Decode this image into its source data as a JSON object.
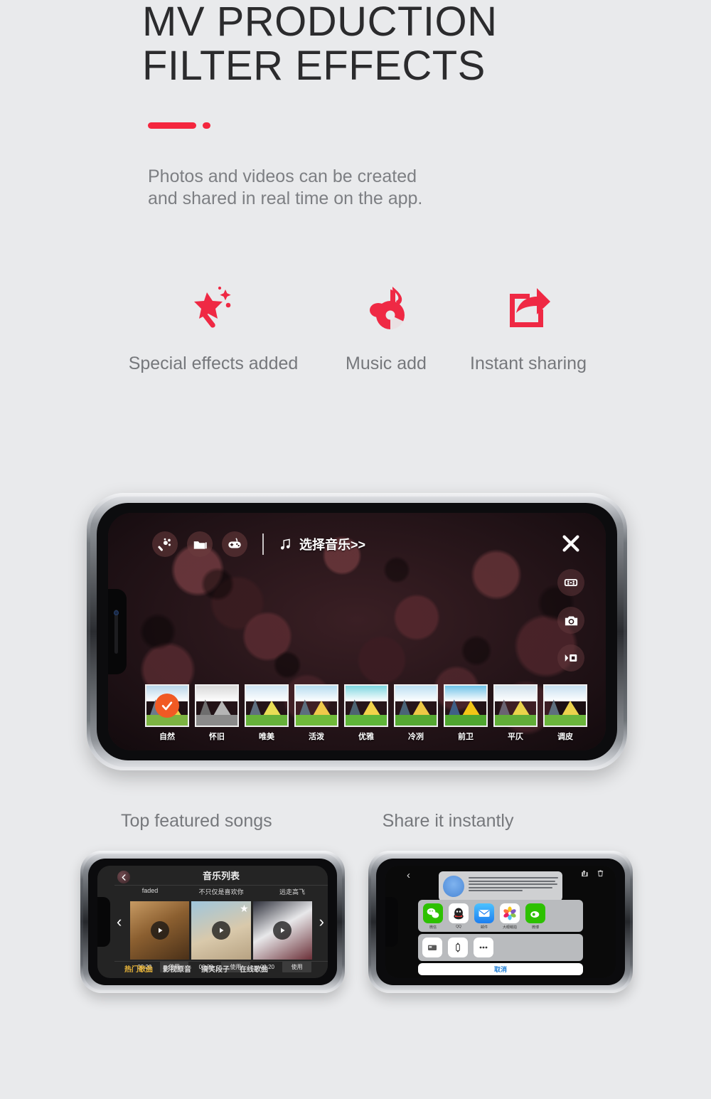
{
  "header": {
    "title_line1": "MV PRODUCTION",
    "title_line2": "FILTER EFFECTS",
    "subtitle_line1": "Photos and videos can be created",
    "subtitle_line2": "and shared in real time on the app.",
    "accent_color": "#f4263e"
  },
  "features": [
    {
      "label": "Special effects added",
      "icon": "magic-wand-icon"
    },
    {
      "label": "Music add",
      "icon": "music-disc-icon"
    },
    {
      "label": "Instant sharing",
      "icon": "share-export-icon"
    }
  ],
  "main_phone": {
    "toolbar": {
      "effects_icon": "magic-wand-icon",
      "frames_icon": "folder-icon",
      "sticker_icon": "game-controller-icon",
      "music_icon": "music-note-icon",
      "music_label": "选择音乐>>"
    },
    "rail": {
      "close_icon": "close-icon",
      "filter_icon": "filter-grid-icon",
      "camera_icon": "camera-icon",
      "video_icon": "video-icon"
    },
    "filters": [
      {
        "label": "自然",
        "selected": true,
        "sky": "#b9d6ea",
        "mountain": "#6b7b8c",
        "grass": "#7cb342",
        "highlight": "#e8d44a"
      },
      {
        "label": "怀旧",
        "selected": false,
        "sky": "#d8d8d8",
        "mountain": "#6e6e6e",
        "grass": "#8a8a8a",
        "highlight": "#b5b5b5"
      },
      {
        "label": "唯美",
        "selected": false,
        "sky": "#cfe4f2",
        "mountain": "#5f6f80",
        "grass": "#66b13a",
        "highlight": "#e8dd55"
      },
      {
        "label": "活泼",
        "selected": false,
        "sky": "#b6dcf0",
        "mountain": "#5c6e7e",
        "grass": "#6fba3a",
        "highlight": "#f0c94a"
      },
      {
        "label": "优雅",
        "selected": false,
        "sky": "#7ed6e0",
        "mountain": "#4d6472",
        "grass": "#5fb539",
        "highlight": "#f2d24a"
      },
      {
        "label": "冷冽",
        "selected": false,
        "sky": "#bcdff2",
        "mountain": "#4a6478",
        "grass": "#55a832",
        "highlight": "#edc845"
      },
      {
        "label": "前卫",
        "selected": false,
        "sky": "#6fc2e8",
        "mountain": "#3f5f86",
        "grass": "#4fa530",
        "highlight": "#f2c516"
      },
      {
        "label": "平仄",
        "selected": false,
        "sky": "#cfe0ec",
        "mountain": "#6a6472",
        "grass": "#61ad38",
        "highlight": "#ead34a"
      },
      {
        "label": "调皮",
        "selected": false,
        "sky": "#c7dff0",
        "mountain": "#5e6f7e",
        "grass": "#6bb53c",
        "highlight": "#ecd24d"
      }
    ],
    "selected_check_color": "#f15a24"
  },
  "captions": {
    "left": "Top featured songs",
    "right": "Share it instantly"
  },
  "music_phone": {
    "title": "音乐列表",
    "back_icon": "chevron-left-icon",
    "prev_icon": "chevron-left-icon",
    "next_icon": "chevron-right-icon",
    "songs": [
      {
        "name": "faded",
        "time": "00:20",
        "use": "使用"
      },
      {
        "name": "不只仅是喜欢你",
        "time": "00:20",
        "use": "使用"
      },
      {
        "name": "远走高飞",
        "time": "00:20",
        "use": "使用"
      }
    ],
    "tabs": [
      {
        "label": "热门歌曲",
        "active": true
      },
      {
        "label": "影视原音",
        "active": false
      },
      {
        "label": "搞笑段子",
        "active": false
      },
      {
        "label": "在线歌曲",
        "active": false
      }
    ],
    "active_tab_color": "#e8b53a"
  },
  "share_phone": {
    "back_icon": "chevron-left-icon",
    "share_icon": "share-icon",
    "delete_icon": "trash-icon",
    "apps": [
      {
        "label": "微信",
        "icon": "wechat-icon",
        "color": "#2dc100"
      },
      {
        "label": "QQ",
        "icon": "qq-icon",
        "color": "#ffffff"
      },
      {
        "label": "邮件",
        "icon": "mail-icon",
        "color": "#1d9bf6"
      },
      {
        "label": "大眼萌拍",
        "icon": "photos-icon",
        "color": "#ffffff"
      },
      {
        "label": "微博",
        "icon": "weibo-icon",
        "color": "#2dc100"
      }
    ],
    "actions": [
      {
        "icon": "copy-icon"
      },
      {
        "icon": "watch-icon"
      },
      {
        "icon": "more-icon"
      }
    ],
    "cancel_label": "取消"
  }
}
